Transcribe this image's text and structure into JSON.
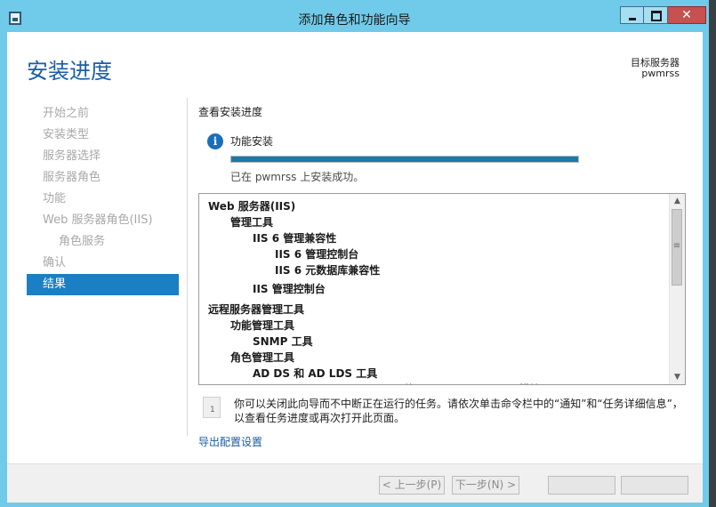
{
  "window": {
    "title": "添加角色和功能向导",
    "close_glyph": "✕"
  },
  "header": {
    "page_title": "安装进度",
    "destination_label": "目标服务器",
    "destination_server": "pwmrss"
  },
  "nav": {
    "items": [
      {
        "label": "开始之前",
        "state": "disabled",
        "indent": 0
      },
      {
        "label": "安装类型",
        "state": "disabled",
        "indent": 0
      },
      {
        "label": "服务器选择",
        "state": "disabled",
        "indent": 0
      },
      {
        "label": "服务器角色",
        "state": "disabled",
        "indent": 0
      },
      {
        "label": "功能",
        "state": "disabled",
        "indent": 0
      },
      {
        "label": "Web 服务器角色(IIS)",
        "state": "disabled",
        "indent": 0
      },
      {
        "label": "角色服务",
        "state": "disabled",
        "indent": 1
      },
      {
        "label": "确认",
        "state": "disabled",
        "indent": 0
      },
      {
        "label": "结果",
        "state": "active",
        "indent": 0
      }
    ]
  },
  "main": {
    "section_label": "查看安装进度",
    "info_icon_glyph": "i",
    "feature_label": "功能安装",
    "progress_fraction": 1.0,
    "status_text": "已在 pwmrss 上安装成功。",
    "results": [
      {
        "label": "Web 服务器(IIS)",
        "level": 0
      },
      {
        "label": "管理工具",
        "level": 1
      },
      {
        "label": "IIS 6 管理兼容性",
        "level": 2
      },
      {
        "label": "IIS 6 管理控制台",
        "level": 3
      },
      {
        "label": "IIS 6 元数据库兼容性",
        "level": 3
      },
      {
        "label": "IIS 管理控制台",
        "level": 2
      },
      {
        "label": "远程服务器管理工具",
        "level": 0
      },
      {
        "label": "功能管理工具",
        "level": 1
      },
      {
        "label": "SNMP 工具",
        "level": 2
      },
      {
        "label": "角色管理工具",
        "level": 1
      },
      {
        "label": "AD DS 和 AD LDS 工具",
        "level": 2
      },
      {
        "label": "Windows PowerShell 的 Active Directory 模块",
        "level": 3
      }
    ],
    "note_text": "你可以关闭此向导而不中断正在运行的任务。请依次单击命令栏中的“通知”和“任务详细信息”，以查看任务进度或再次打开此页面。",
    "note_icon_glyph": "1",
    "export_link": "导出配置设置"
  },
  "footer": {
    "prev_label": "< 上一步(P)",
    "next_label": "下一步(N) >",
    "install_label": "",
    "cancel_label": ""
  },
  "scrollbar": {
    "up_glyph": "▲",
    "down_glyph": "▼",
    "grip_glyph": "≡"
  },
  "colors": {
    "title_bar": "#6fcbe9",
    "accent": "#1b7fc4",
    "progress": "#1b7aa8",
    "close_button": "#c75050"
  }
}
